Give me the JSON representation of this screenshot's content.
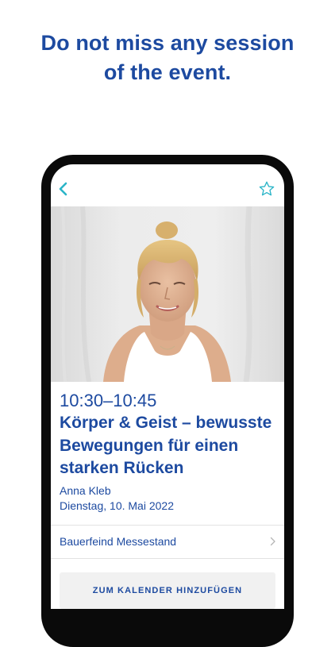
{
  "headline": {
    "line1": "Do not miss any session",
    "line2": "of the event."
  },
  "session": {
    "time": "10:30–10:45",
    "title": "Körper & Geist – bewusste Bewegungen für einen starken Rücken",
    "speaker": "Anna Kleb",
    "date": "Dienstag, 10. Mai 2022",
    "location": "Bauerfeind Messestand",
    "calendar_button_label": "ZUM KALENDER HINZUFÜGEN"
  },
  "icons": {
    "back": "chevron-left-icon",
    "favorite": "star-outline-icon",
    "location_arrow": "chevron-right-icon"
  },
  "colors": {
    "primary_text": "#1d4aa0",
    "accent_icon": "#2bb5c8",
    "phone_frame": "#0a0a0a",
    "button_background": "#f1f1f1"
  }
}
